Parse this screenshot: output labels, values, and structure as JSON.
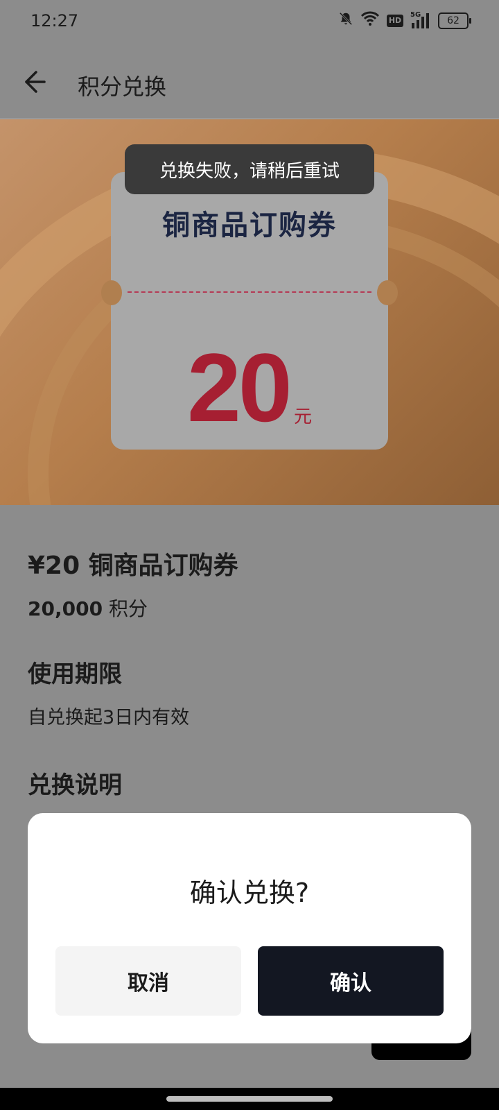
{
  "status_bar": {
    "time": "12:27",
    "icons": [
      "bell-off-icon",
      "wifi-icon",
      "hd-icon",
      "signal-5g-icon"
    ],
    "hd_label": "HD",
    "network_label": "5G",
    "battery": "62"
  },
  "header": {
    "title": "积分兑换",
    "back_icon": "arrow-left-icon"
  },
  "voucher": {
    "title": "铜商品订购券",
    "amount": "20",
    "unit": "元"
  },
  "toast": {
    "message": "兑换失败，请稍后重试"
  },
  "details": {
    "product_name": "¥20 铜商品订购券",
    "points_value": "20,000",
    "points_unit": "积分",
    "validity_heading": "使用期限",
    "validity_text": "自兑换起3日内有效",
    "explain_heading": "兑换说明"
  },
  "dialog": {
    "title": "确认兑换?",
    "cancel_label": "取消",
    "confirm_label": "确认"
  },
  "colors": {
    "overlay": "#8c8c8c",
    "banner": "#b57e4c",
    "amount": "#a61f32",
    "dark_button": "#131722"
  }
}
